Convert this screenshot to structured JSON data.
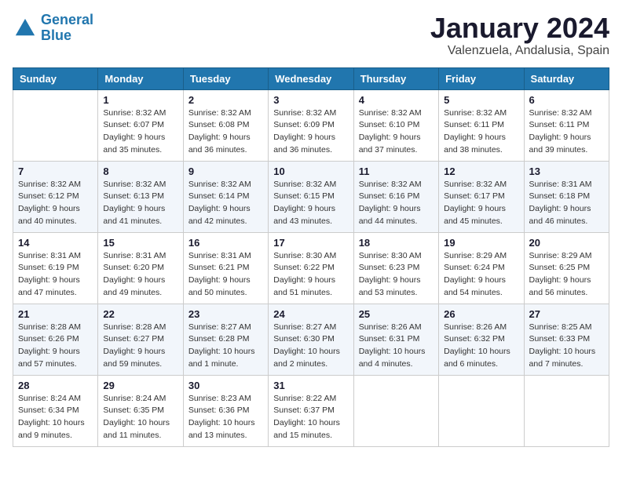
{
  "logo": {
    "line1": "General",
    "line2": "Blue"
  },
  "title": "January 2024",
  "subtitle": "Valenzuela, Andalusia, Spain",
  "header_days": [
    "Sunday",
    "Monday",
    "Tuesday",
    "Wednesday",
    "Thursday",
    "Friday",
    "Saturday"
  ],
  "weeks": [
    [
      {
        "day": "",
        "sunrise": "",
        "sunset": "",
        "daylight": ""
      },
      {
        "day": "1",
        "sunrise": "Sunrise: 8:32 AM",
        "sunset": "Sunset: 6:07 PM",
        "daylight": "Daylight: 9 hours and 35 minutes."
      },
      {
        "day": "2",
        "sunrise": "Sunrise: 8:32 AM",
        "sunset": "Sunset: 6:08 PM",
        "daylight": "Daylight: 9 hours and 36 minutes."
      },
      {
        "day": "3",
        "sunrise": "Sunrise: 8:32 AM",
        "sunset": "Sunset: 6:09 PM",
        "daylight": "Daylight: 9 hours and 36 minutes."
      },
      {
        "day": "4",
        "sunrise": "Sunrise: 8:32 AM",
        "sunset": "Sunset: 6:10 PM",
        "daylight": "Daylight: 9 hours and 37 minutes."
      },
      {
        "day": "5",
        "sunrise": "Sunrise: 8:32 AM",
        "sunset": "Sunset: 6:11 PM",
        "daylight": "Daylight: 9 hours and 38 minutes."
      },
      {
        "day": "6",
        "sunrise": "Sunrise: 8:32 AM",
        "sunset": "Sunset: 6:11 PM",
        "daylight": "Daylight: 9 hours and 39 minutes."
      }
    ],
    [
      {
        "day": "7",
        "sunrise": "Sunrise: 8:32 AM",
        "sunset": "Sunset: 6:12 PM",
        "daylight": "Daylight: 9 hours and 40 minutes."
      },
      {
        "day": "8",
        "sunrise": "Sunrise: 8:32 AM",
        "sunset": "Sunset: 6:13 PM",
        "daylight": "Daylight: 9 hours and 41 minutes."
      },
      {
        "day": "9",
        "sunrise": "Sunrise: 8:32 AM",
        "sunset": "Sunset: 6:14 PM",
        "daylight": "Daylight: 9 hours and 42 minutes."
      },
      {
        "day": "10",
        "sunrise": "Sunrise: 8:32 AM",
        "sunset": "Sunset: 6:15 PM",
        "daylight": "Daylight: 9 hours and 43 minutes."
      },
      {
        "day": "11",
        "sunrise": "Sunrise: 8:32 AM",
        "sunset": "Sunset: 6:16 PM",
        "daylight": "Daylight: 9 hours and 44 minutes."
      },
      {
        "day": "12",
        "sunrise": "Sunrise: 8:32 AM",
        "sunset": "Sunset: 6:17 PM",
        "daylight": "Daylight: 9 hours and 45 minutes."
      },
      {
        "day": "13",
        "sunrise": "Sunrise: 8:31 AM",
        "sunset": "Sunset: 6:18 PM",
        "daylight": "Daylight: 9 hours and 46 minutes."
      }
    ],
    [
      {
        "day": "14",
        "sunrise": "Sunrise: 8:31 AM",
        "sunset": "Sunset: 6:19 PM",
        "daylight": "Daylight: 9 hours and 47 minutes."
      },
      {
        "day": "15",
        "sunrise": "Sunrise: 8:31 AM",
        "sunset": "Sunset: 6:20 PM",
        "daylight": "Daylight: 9 hours and 49 minutes."
      },
      {
        "day": "16",
        "sunrise": "Sunrise: 8:31 AM",
        "sunset": "Sunset: 6:21 PM",
        "daylight": "Daylight: 9 hours and 50 minutes."
      },
      {
        "day": "17",
        "sunrise": "Sunrise: 8:30 AM",
        "sunset": "Sunset: 6:22 PM",
        "daylight": "Daylight: 9 hours and 51 minutes."
      },
      {
        "day": "18",
        "sunrise": "Sunrise: 8:30 AM",
        "sunset": "Sunset: 6:23 PM",
        "daylight": "Daylight: 9 hours and 53 minutes."
      },
      {
        "day": "19",
        "sunrise": "Sunrise: 8:29 AM",
        "sunset": "Sunset: 6:24 PM",
        "daylight": "Daylight: 9 hours and 54 minutes."
      },
      {
        "day": "20",
        "sunrise": "Sunrise: 8:29 AM",
        "sunset": "Sunset: 6:25 PM",
        "daylight": "Daylight: 9 hours and 56 minutes."
      }
    ],
    [
      {
        "day": "21",
        "sunrise": "Sunrise: 8:28 AM",
        "sunset": "Sunset: 6:26 PM",
        "daylight": "Daylight: 9 hours and 57 minutes."
      },
      {
        "day": "22",
        "sunrise": "Sunrise: 8:28 AM",
        "sunset": "Sunset: 6:27 PM",
        "daylight": "Daylight: 9 hours and 59 minutes."
      },
      {
        "day": "23",
        "sunrise": "Sunrise: 8:27 AM",
        "sunset": "Sunset: 6:28 PM",
        "daylight": "Daylight: 10 hours and 1 minute."
      },
      {
        "day": "24",
        "sunrise": "Sunrise: 8:27 AM",
        "sunset": "Sunset: 6:30 PM",
        "daylight": "Daylight: 10 hours and 2 minutes."
      },
      {
        "day": "25",
        "sunrise": "Sunrise: 8:26 AM",
        "sunset": "Sunset: 6:31 PM",
        "daylight": "Daylight: 10 hours and 4 minutes."
      },
      {
        "day": "26",
        "sunrise": "Sunrise: 8:26 AM",
        "sunset": "Sunset: 6:32 PM",
        "daylight": "Daylight: 10 hours and 6 minutes."
      },
      {
        "day": "27",
        "sunrise": "Sunrise: 8:25 AM",
        "sunset": "Sunset: 6:33 PM",
        "daylight": "Daylight: 10 hours and 7 minutes."
      }
    ],
    [
      {
        "day": "28",
        "sunrise": "Sunrise: 8:24 AM",
        "sunset": "Sunset: 6:34 PM",
        "daylight": "Daylight: 10 hours and 9 minutes."
      },
      {
        "day": "29",
        "sunrise": "Sunrise: 8:24 AM",
        "sunset": "Sunset: 6:35 PM",
        "daylight": "Daylight: 10 hours and 11 minutes."
      },
      {
        "day": "30",
        "sunrise": "Sunrise: 8:23 AM",
        "sunset": "Sunset: 6:36 PM",
        "daylight": "Daylight: 10 hours and 13 minutes."
      },
      {
        "day": "31",
        "sunrise": "Sunrise: 8:22 AM",
        "sunset": "Sunset: 6:37 PM",
        "daylight": "Daylight: 10 hours and 15 minutes."
      },
      {
        "day": "",
        "sunrise": "",
        "sunset": "",
        "daylight": ""
      },
      {
        "day": "",
        "sunrise": "",
        "sunset": "",
        "daylight": ""
      },
      {
        "day": "",
        "sunrise": "",
        "sunset": "",
        "daylight": ""
      }
    ]
  ]
}
